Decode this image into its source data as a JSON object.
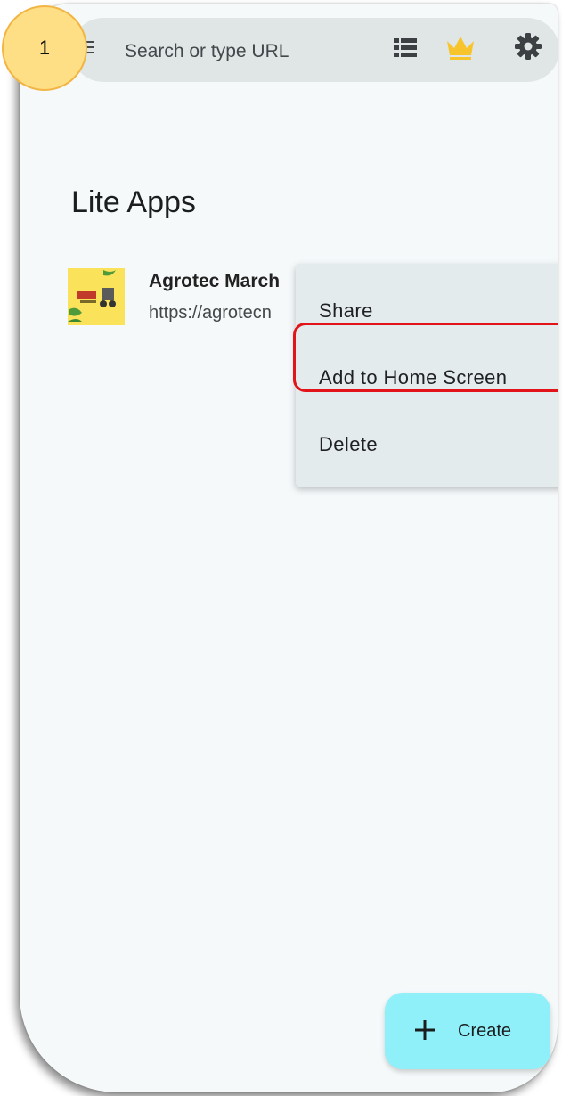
{
  "step_badge": "1",
  "search": {
    "placeholder": "Search or type URL",
    "icons": [
      "menu-icon",
      "list-icon",
      "crown-icon",
      "gear-icon"
    ],
    "crown_color": "#f7c52b"
  },
  "lite_apps": {
    "title": "Lite Apps",
    "items": [
      {
        "name": "Agrotec March",
        "url": "https://agrotecn",
        "thumbnail_color": "#fbe25b"
      }
    ]
  },
  "context_menu": {
    "items": [
      "Share",
      "Add to Home Screen",
      "Delete"
    ],
    "highlighted_item": "Add to Home Screen",
    "highlight_color": "#e2141a"
  },
  "fab": {
    "label": "Create",
    "icon": "plus-icon",
    "color": "#8ff0fa"
  }
}
